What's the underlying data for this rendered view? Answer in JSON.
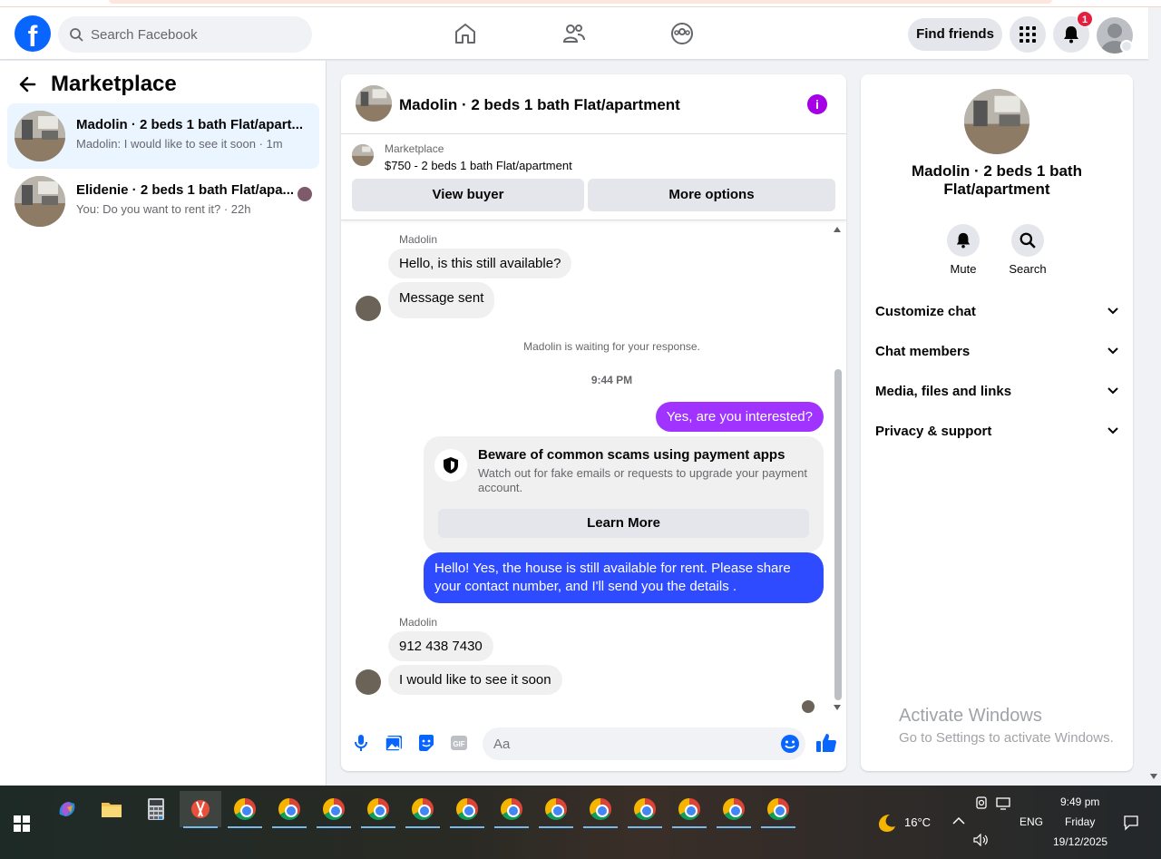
{
  "browser": {},
  "topnav": {
    "logo": "f",
    "search_placeholder": "Search Facebook",
    "find_friends": "Find friends",
    "notification_count": "1",
    "icons": [
      "home-icon",
      "friends-icon",
      "groups-icon",
      "menu-grid-icon",
      "bell-icon"
    ]
  },
  "left": {
    "title": "Marketplace",
    "conversations": [
      {
        "name": "Madolin · 2 beds 1 bath Flat/apart...",
        "preview": "Madolin: I would like to see it soon · 1m",
        "active": true
      },
      {
        "name": "Elidenie · 2 beds 1 bath Flat/apa...",
        "preview": "You: Do you want to rent it? · 22h",
        "active": false
      }
    ]
  },
  "chat": {
    "title": "Madolin · 2 beds 1 bath Flat/apartment",
    "marketplace_label": "Marketplace",
    "listing": "$750 - 2 beds 1 bath Flat/apartment",
    "view_buyer": "View buyer",
    "more_options": "More options",
    "messages": {
      "sender1": "Madolin",
      "in1": "Hello, is this still available?",
      "in2": "Message sent",
      "waiting": "Madolin is waiting for your response.",
      "time": "9:44 PM",
      "out1": "Yes, are you interested?",
      "scam_title": "Beware of common scams using payment apps",
      "scam_body": "Watch out for fake emails or requests to upgrade your payment account.",
      "learn_more": "Learn More",
      "out2": "Hello! Yes, the house is still available for rent. Please share your contact number, and I'll send you the details .",
      "sender2": "Madolin",
      "in3": "912 438 7430",
      "in4": "I would like to see it soon"
    },
    "composer_placeholder": "Aa"
  },
  "right": {
    "title": "Madolin · 2 beds 1 bath Flat/apartment",
    "mute": "Mute",
    "search": "Search",
    "sections": [
      "Customize chat",
      "Chat members",
      "Media, files and links",
      "Privacy & support"
    ],
    "activate_title": "Activate Windows",
    "activate_body": "Go to Settings to activate Windows."
  },
  "taskbar": {
    "weather": "16°C",
    "lang": "ENG",
    "time": "9:49 pm",
    "day": "Friday",
    "date": "19/12/2025"
  },
  "colors": {
    "fb_blue": "#0866ff",
    "outgoing_purple": "#a033ff",
    "outgoing_blue": "#2f4bff",
    "info_purple": "#a500e6",
    "badge_red": "#e41e3f"
  }
}
